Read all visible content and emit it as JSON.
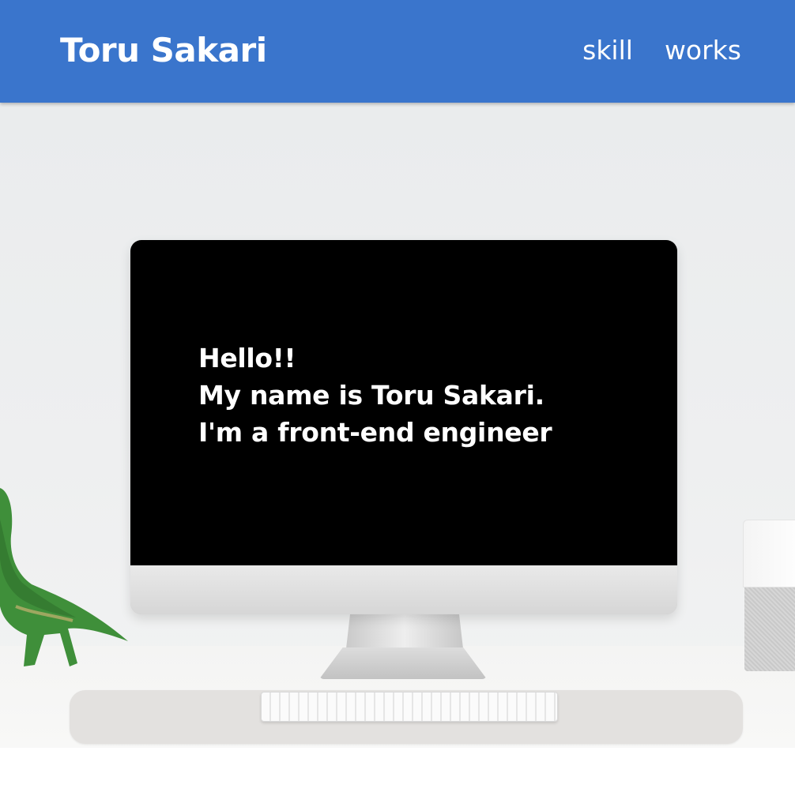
{
  "header": {
    "title": "Toru Sakari",
    "nav": [
      {
        "label": "skill"
      },
      {
        "label": "works"
      }
    ],
    "background_color": "#3a75cc"
  },
  "hero": {
    "greeting_lines": [
      "Hello!!",
      "My name is Toru Sakari.",
      "I'm a front-end engineer"
    ],
    "screen_color": "#000000",
    "text_color": "#ffffff"
  }
}
